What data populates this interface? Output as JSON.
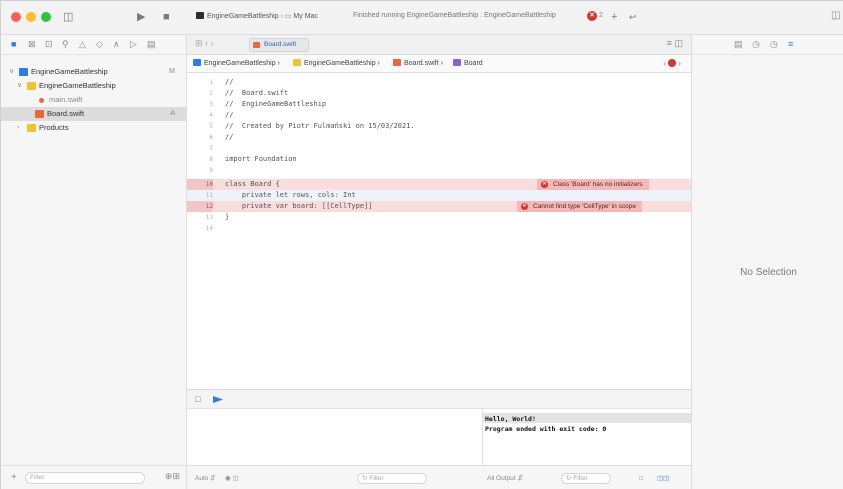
{
  "toolbar": {
    "scheme": "EngineGameBattleship",
    "destination": "My Mac",
    "activity": "Finished running EngineGameBattleship : EngineGameBattleship",
    "error_count": "2",
    "add_label": "+",
    "expand_label": "↩"
  },
  "navigator": {
    "items": [
      {
        "label": "EngineGameBattleship",
        "badge": "M"
      },
      {
        "label": "EngineGameBattleship",
        "badge": ""
      },
      {
        "label": "main.swift",
        "badge": ""
      },
      {
        "label": "Board.swift",
        "badge": "A"
      },
      {
        "label": "Products",
        "badge": ""
      }
    ],
    "filter_placeholder": "Filter"
  },
  "tabs": [
    {
      "label": "Board.swift"
    }
  ],
  "jumpbar": {
    "segments": [
      "EngineGameBattleship",
      "EngineGameBattleship",
      "Board.swift",
      "Board"
    ]
  },
  "code": {
    "lines": [
      {
        "n": "1",
        "text": "//"
      },
      {
        "n": "2",
        "text": "//  Board.swift"
      },
      {
        "n": "3",
        "text": "//  EngineGameBattleship"
      },
      {
        "n": "4",
        "text": "//"
      },
      {
        "n": "5",
        "text": "//  Created by Piotr Fulmański on 15/03/2021."
      },
      {
        "n": "6",
        "text": "//"
      },
      {
        "n": "7",
        "text": ""
      },
      {
        "n": "8",
        "text": "import Foundation"
      },
      {
        "n": "9",
        "text": ""
      },
      {
        "n": "10",
        "text": "class Board {"
      },
      {
        "n": "11",
        "text": "    private let rows, cols: Int"
      },
      {
        "n": "12",
        "text": "    private var board: [[CellType]]"
      },
      {
        "n": "13",
        "text": "}"
      },
      {
        "n": "14",
        "text": ""
      }
    ]
  },
  "issues": [
    {
      "message": "Class 'Board' has no initializers"
    },
    {
      "message": "Cannot find type 'CellType' in scope"
    }
  ],
  "console": {
    "output_line1": "Hello, World!",
    "output_line2": "Program ended with exit code: 0"
  },
  "bottom_bar": {
    "auto_label": "Auto",
    "filter1_placeholder": "Filter",
    "output_label": "All Output",
    "filter2_placeholder": "Filter"
  },
  "inspector": {
    "no_selection": "No Selection"
  }
}
